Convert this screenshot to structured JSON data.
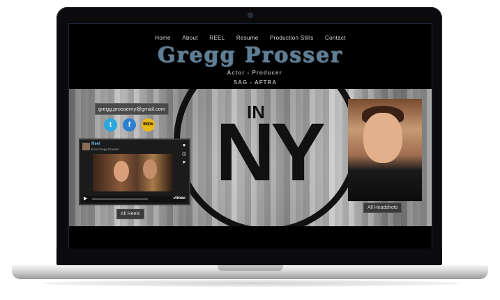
{
  "nav": [
    "Home",
    "About",
    "REEL",
    "Resume",
    "Production Stills",
    "Contact"
  ],
  "site": {
    "title": "Gregg Prosser",
    "subtitle": "Actor - Producer",
    "union": "SAG - AFTRA"
  },
  "hero": {
    "in_text": "IN",
    "ny_text": "NY"
  },
  "contact": {
    "email": "gregg.prosserny@gmail.com"
  },
  "social": {
    "twitter": "t",
    "facebook": "f",
    "imdb": "IMDb"
  },
  "player": {
    "title": "Reel",
    "from": "from Gregg Prosser",
    "logo": "vimeo"
  },
  "buttons": {
    "reels": "All Reels",
    "headshots": "All Headshots"
  }
}
